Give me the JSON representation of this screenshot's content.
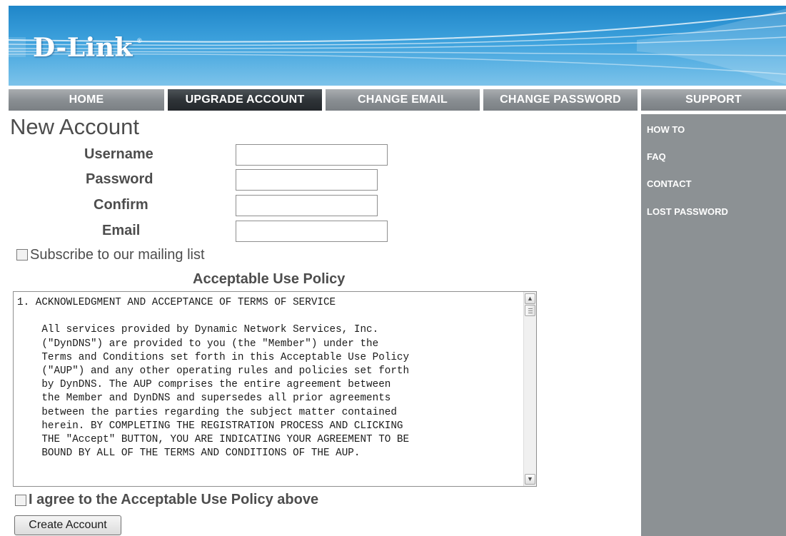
{
  "header": {
    "logo_text": "D-Link",
    "logo_mark": "®"
  },
  "nav": {
    "items": [
      {
        "label": "HOME"
      },
      {
        "label": "UPGRADE ACCOUNT",
        "active": true
      },
      {
        "label": "CHANGE EMAIL"
      },
      {
        "label": "CHANGE PASSWORD"
      },
      {
        "label": "SUPPORT"
      }
    ]
  },
  "sidebar": {
    "links": [
      {
        "label": "HOW TO"
      },
      {
        "label": "FAQ"
      },
      {
        "label": "CONTACT"
      },
      {
        "label": "LOST PASSWORD"
      }
    ]
  },
  "form": {
    "title": "New Account",
    "username": {
      "label": "Username",
      "value": ""
    },
    "password": {
      "label": "Password",
      "value": ""
    },
    "confirm": {
      "label": "Confirm",
      "value": ""
    },
    "email": {
      "label": "Email",
      "value": ""
    },
    "subscribe": {
      "label": "Subscribe to our mailing list",
      "checked": false
    }
  },
  "policy": {
    "title": "Acceptable Use Policy",
    "text": "1. ACKNOWLEDGMENT AND ACCEPTANCE OF TERMS OF SERVICE\n\n    All services provided by Dynamic Network Services, Inc.\n    (\"DynDNS\") are provided to you (the \"Member\") under the\n    Terms and Conditions set forth in this Acceptable Use Policy\n    (\"AUP\") and any other operating rules and policies set forth\n    by DynDNS. The AUP comprises the entire agreement between\n    the Member and DynDNS and supersedes all prior agreements\n    between the parties regarding the subject matter contained\n    herein. BY COMPLETING THE REGISTRATION PROCESS AND CLICKING\n    THE \"Accept\" BUTTON, YOU ARE INDICATING YOUR AGREEMENT TO BE\n    BOUND BY ALL OF THE TERMS AND CONDITIONS OF THE AUP.",
    "agree_label": "I agree to the Acceptable Use Policy above",
    "agree_checked": false
  },
  "actions": {
    "create_label": "Create Account"
  },
  "colors": {
    "banner_blue": "#2f94d4",
    "nav_gray": "#8a8f93",
    "nav_active": "#2f3438",
    "sidebar_gray": "#8c9194",
    "text_gray": "#4d4d4d"
  }
}
